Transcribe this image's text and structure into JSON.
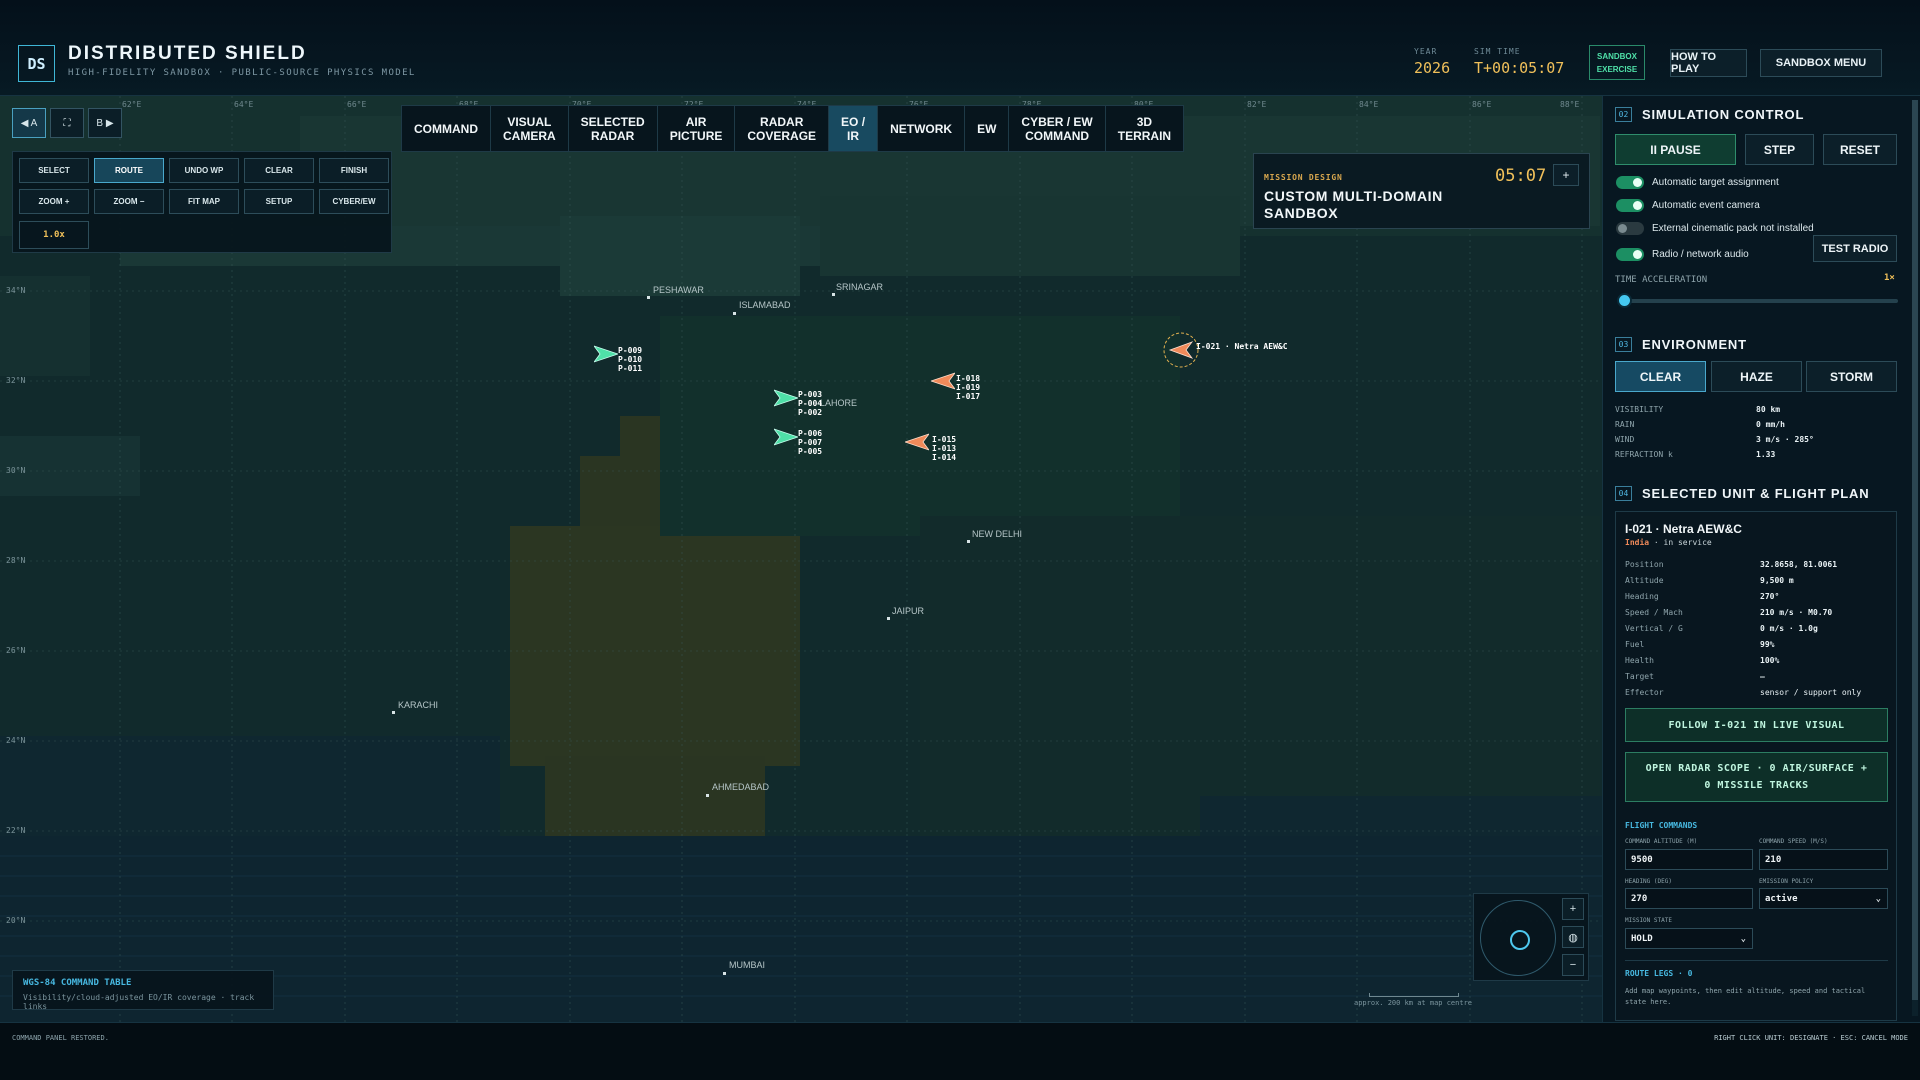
{
  "header": {
    "logo": "DS",
    "title": "DISTRIBUTED SHIELD",
    "subtitle": "HIGH-FIDELITY SANDBOX · PUBLIC-SOURCE PHYSICS MODEL",
    "year_label": "YEAR",
    "year": "2026",
    "simtime_label": "SIM TIME",
    "simtime": "T+00:05:07",
    "badge_line1": "SANDBOX",
    "badge_line2": "EXERCISE",
    "how_to_play": "HOW TO PLAY",
    "sandbox_menu": "SANDBOX MENU"
  },
  "map_nav": {
    "prev": "◀ A",
    "fullscreen": "⛶",
    "next": "B ▶"
  },
  "tools": {
    "select": "SELECT",
    "route": "ROUTE",
    "undo_wp": "UNDO WP",
    "clear": "CLEAR",
    "finish": "FINISH",
    "zoom_in": "ZOOM +",
    "zoom_out": "ZOOM −",
    "fit_map": "FIT MAP",
    "setup": "SETUP",
    "cyber_ew": "CYBER/EW",
    "zoom_level": "1.0x"
  },
  "tabs": [
    {
      "line1": "COMMAND",
      "line2": ""
    },
    {
      "line1": "VISUAL",
      "line2": "CAMERA"
    },
    {
      "line1": "SELECTED",
      "line2": "RADAR"
    },
    {
      "line1": "AIR",
      "line2": "PICTURE"
    },
    {
      "line1": "RADAR",
      "line2": "COVERAGE"
    },
    {
      "line1": "EO /",
      "line2": "IR"
    },
    {
      "line1": "NETWORK",
      "line2": ""
    },
    {
      "line1": "EW",
      "line2": ""
    },
    {
      "line1": "CYBER / EW",
      "line2": "COMMAND"
    },
    {
      "line1": "3D",
      "line2": "TERRAIN"
    }
  ],
  "active_tab": "EO / IR",
  "mission": {
    "caption": "MISSION DESIGN",
    "title": "CUSTOM MULTI-DOMAIN SANDBOX",
    "clock": "05:07",
    "plus": "+"
  },
  "map": {
    "lat_labels": [
      "34°N",
      "32°N",
      "30°N",
      "28°N",
      "26°N",
      "24°N",
      "22°N",
      "20°N"
    ],
    "lon_labels": [
      "62°E",
      "64°E",
      "66°E",
      "68°E",
      "70°E",
      "72°E",
      "74°E",
      "76°E",
      "78°E",
      "80°E",
      "82°E",
      "84°E",
      "86°E",
      "88°E"
    ],
    "cities": [
      "PESHAWAR",
      "ISLAMABAD",
      "SRINAGAR",
      "LAHORE",
      "NEW DELHI",
      "JAIPUR",
      "KARACHI",
      "AHMEDABAD",
      "MUMBAI"
    ],
    "blue_groups": [
      [
        "P-009",
        "P-010",
        "P-011"
      ],
      [
        "P-003",
        "P-004",
        "P-002"
      ],
      [
        "P-006",
        "P-007",
        "P-005"
      ]
    ],
    "red_groups": [
      [
        "I-018",
        "I-019",
        "I-017"
      ],
      [
        "I-015",
        "I-013",
        "I-014"
      ]
    ],
    "selected_unit_label": "I-021 · Netra AEW&C",
    "legend_title": "WGS-84 COMMAND TABLE",
    "legend_sub": "Visibility/cloud-adjusted EO/IR coverage · track links",
    "scale_label": "approx. 200 km at map centre",
    "compass_plus": "+",
    "compass_globe": "◍",
    "compass_minus": "−",
    "colors": {
      "friendly": "#4fe0a8",
      "hostile": "#f08a5a",
      "accent": "#45c8f0"
    }
  },
  "simulation": {
    "num": "02",
    "title": "SIMULATION CONTROL",
    "pause": "II PAUSE",
    "step": "STEP",
    "reset": "RESET",
    "toggles": [
      {
        "label": "Automatic target assignment",
        "on": true
      },
      {
        "label": "Automatic event camera",
        "on": true
      },
      {
        "label": "External cinematic pack not installed",
        "on": false
      },
      {
        "label": "Radio / network audio",
        "on": true
      }
    ],
    "test_radio": "TEST RADIO",
    "time_accel_label": "TIME ACCELERATION",
    "time_accel_value": "1×",
    "time_accel_fraction": 0.0
  },
  "environment": {
    "num": "03",
    "title": "ENVIRONMENT",
    "clear": "CLEAR",
    "haze": "HAZE",
    "storm": "STORM",
    "rows": [
      {
        "k": "VISIBILITY",
        "v": "80 km"
      },
      {
        "k": "RAIN",
        "v": "0 mm/h"
      },
      {
        "k": "WIND",
        "v": "3 m/s · 285°"
      },
      {
        "k": "REFRACTION k",
        "v": "1.33"
      }
    ]
  },
  "selected_unit": {
    "num": "04",
    "title": "SELECTED UNIT & FLIGHT PLAN",
    "name": "I-021 · Netra AEW&C",
    "country": "India",
    "status": " · in service",
    "rows": [
      {
        "k": "Position",
        "v": "32.8658, 81.0061"
      },
      {
        "k": "Altitude",
        "v": "9,500 m"
      },
      {
        "k": "Heading",
        "v": "270°"
      },
      {
        "k": "Speed / Mach",
        "v": "210 m/s · M0.70"
      },
      {
        "k": "Vertical / G",
        "v": "0 m/s · 1.0g"
      },
      {
        "k": "Fuel",
        "v": "99%"
      },
      {
        "k": "Health",
        "v": "100%"
      },
      {
        "k": "Target",
        "v": "—"
      },
      {
        "k": "Effector",
        "v": "sensor / support only"
      }
    ],
    "follow": "FOLLOW I-021 IN LIVE VISUAL",
    "radar_line1": "OPEN RADAR SCOPE · 0 AIR/SURFACE +",
    "radar_line2": "0 MISSILE TRACKS",
    "flight_commands": "FLIGHT COMMANDS",
    "cmd_alt_label": "COMMAND ALTITUDE (M)",
    "cmd_alt": "9500",
    "cmd_speed_label": "COMMAND SPEED (M/S)",
    "cmd_speed": "210",
    "heading_label": "HEADING (DEG)",
    "heading": "270",
    "emission_label": "EMISSION POLICY",
    "emission": "active",
    "mission_state_label": "MISSION STATE",
    "mission_state": "HOLD",
    "route_legs": "ROUTE LEGS · 0",
    "route_hint": "Add map waypoints, then edit altitude, speed and tactical state here."
  },
  "status": {
    "left": "COMMAND PANEL RESTORED.",
    "right": "RIGHT CLICK UNIT: DESIGNATE · ESC: CANCEL MODE"
  }
}
